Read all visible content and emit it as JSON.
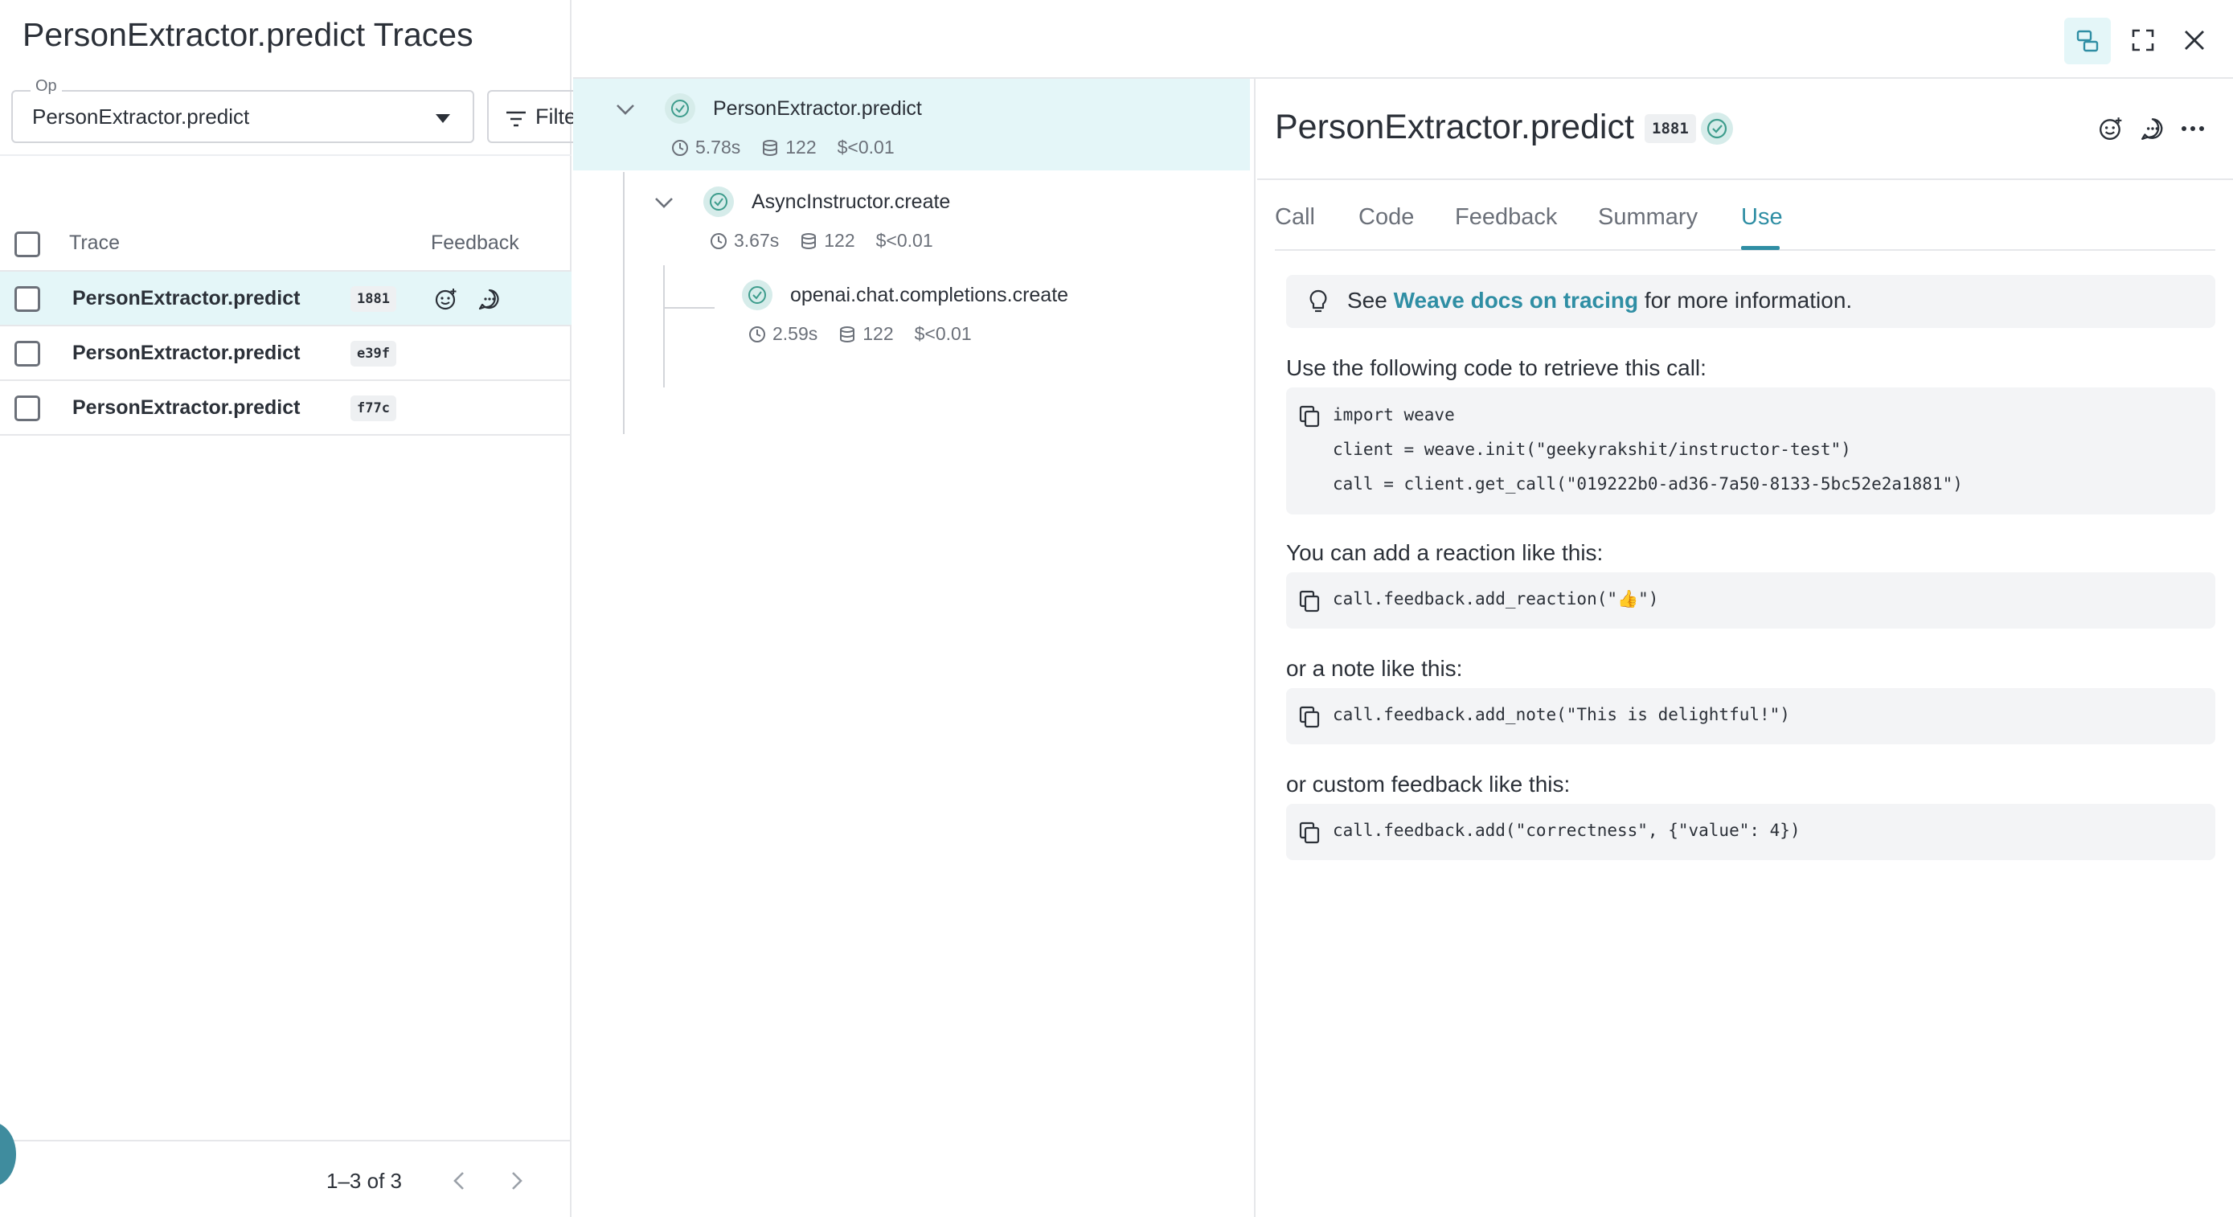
{
  "left": {
    "title": "PersonExtractor.predict Traces",
    "op_label": "Op",
    "op_value": "PersonExtractor.predict",
    "filter_label": "Filte",
    "headers": {
      "trace": "Trace",
      "feedback": "Feedback"
    },
    "rows": [
      {
        "name": "PersonExtractor.predict",
        "badge": "1881"
      },
      {
        "name": "PersonExtractor.predict",
        "badge": "e39f"
      },
      {
        "name": "PersonExtractor.predict",
        "badge": "f77c"
      }
    ],
    "pager": "1–3 of 3"
  },
  "tree": [
    {
      "name": "PersonExtractor.predict",
      "duration": "5.78s",
      "tokens": "122",
      "cost": "$<0.01"
    },
    {
      "name": "AsyncInstructor.create",
      "duration": "3.67s",
      "tokens": "122",
      "cost": "$<0.01"
    },
    {
      "name": "openai.chat.completions.create",
      "duration": "2.59s",
      "tokens": "122",
      "cost": "$<0.01"
    }
  ],
  "call": {
    "title": "PersonExtractor.predict",
    "badge": "1881",
    "tabs": [
      "Call",
      "Code",
      "Feedback",
      "Summary",
      "Use"
    ],
    "active_tab": "Use",
    "docs": {
      "prefix": "See ",
      "link": "Weave docs on tracing",
      "suffix": " for more information."
    },
    "retrieve_label": "Use the following code to retrieve this call:",
    "retrieve_code": [
      "import weave",
      "client = weave.init(\"geekyrakshit/instructor-test\")",
      "call = client.get_call(\"019222b0-ad36-7a50-8133-5bc52e2a1881\")"
    ],
    "reaction_label": "You can add a reaction like this:",
    "reaction_code": "call.feedback.add_reaction(\"👍\")",
    "note_label": "or a note like this:",
    "note_code": "call.feedback.add_note(\"This is delightful!\")",
    "custom_label": "or custom feedback like this:",
    "custom_code": "call.feedback.add(\"correctness\", {\"value\": 4})"
  },
  "colors": {
    "accent": "#2f8ea4",
    "selected_bg": "#e4f6f8",
    "status_ok": "#3d9c8c"
  }
}
